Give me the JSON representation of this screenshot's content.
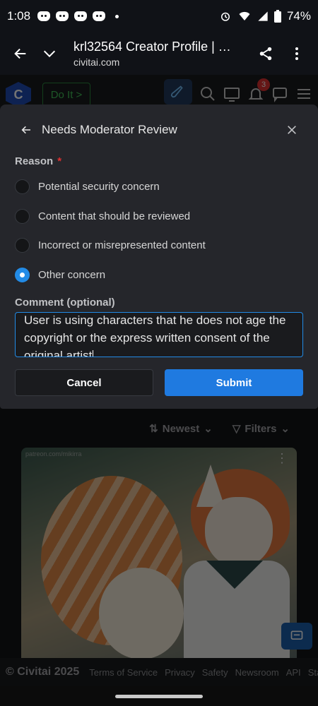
{
  "status_bar": {
    "time": "1:08",
    "battery": "74%"
  },
  "browser": {
    "page_title": "krl32564 Creator Profile | C...",
    "domain": "civitai.com"
  },
  "site_header": {
    "logo_letter": "C",
    "cta_label": "Do It",
    "notification_count": "3"
  },
  "modal": {
    "title": "Needs Moderator Review",
    "reason_label": "Reason",
    "required_mark": "*",
    "options": [
      {
        "label": "Potential security concern",
        "checked": false
      },
      {
        "label": "Content that should be reviewed",
        "checked": false
      },
      {
        "label": "Incorrect or misrepresented content",
        "checked": false
      },
      {
        "label": "Other concern",
        "checked": true
      }
    ],
    "comment_label": "Comment (optional)",
    "comment_value": "User is using characters that he does not age the copyright or the express written consent of the original artist",
    "cancel_label": "Cancel",
    "submit_label": "Submit"
  },
  "sort": {
    "sort_label": "Newest",
    "filter_label": "Filters"
  },
  "image_card": {
    "watermark": "patreon.com/mikirra"
  },
  "footer": {
    "copyright": "© Civitai 2025",
    "links": [
      "Terms of Service",
      "Privacy",
      "Safety",
      "Newsroom",
      "API",
      "Sta"
    ]
  },
  "colors": {
    "accent": "#228be6",
    "submit": "#1f7ae0",
    "required": "#e03131",
    "modal_bg": "#25262b"
  }
}
